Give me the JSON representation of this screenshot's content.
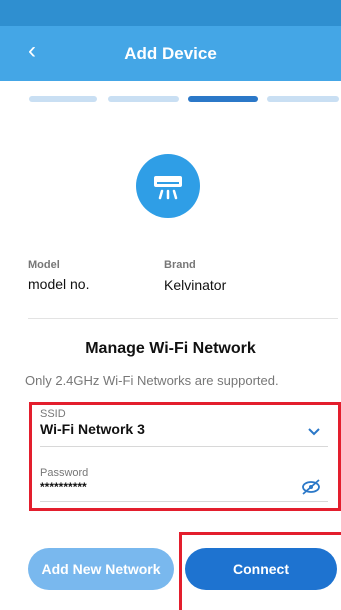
{
  "header": {
    "back_glyph": "‹",
    "title": "Add Device"
  },
  "progress": {
    "total_steps": 4,
    "current_step": 3
  },
  "device": {
    "icon": "air-conditioner-icon",
    "model_label": "Model",
    "model_value": "model no.",
    "brand_label": "Brand",
    "brand_value": "Kelvinator"
  },
  "wifi": {
    "section_title": "Manage Wi-Fi Network",
    "note": "Only 2.4GHz Wi-Fi Networks are supported.",
    "ssid_label": "SSID",
    "ssid_value": "Wi-Fi Network 3",
    "password_label": "Password",
    "password_value": "**********"
  },
  "buttons": {
    "add_network": "Add New Network",
    "connect": "Connect"
  },
  "colors": {
    "header": "#44a6e6",
    "accent": "#2b78c8",
    "highlight": "#e31e2d"
  }
}
